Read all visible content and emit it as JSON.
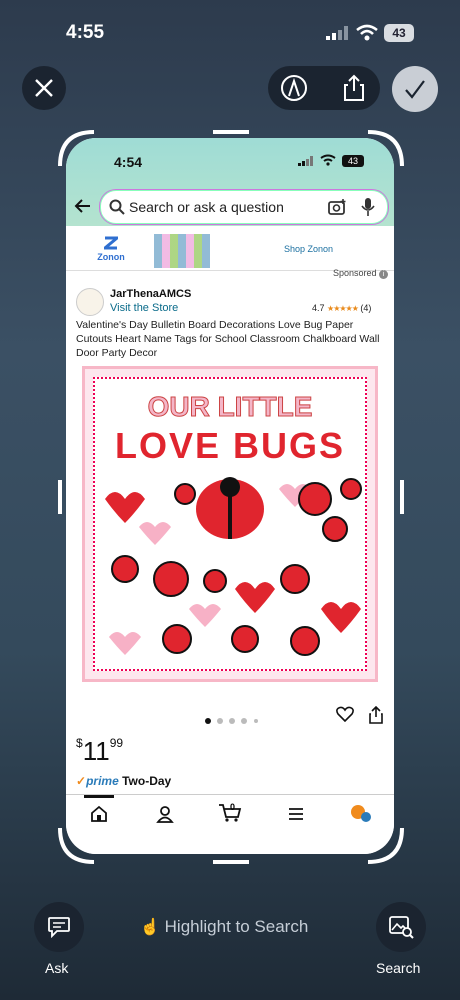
{
  "status": {
    "time": "4:55",
    "battery": "43"
  },
  "toolbar": {
    "close_icon": "close-icon",
    "markup_icon": "markup-pen-icon",
    "share_icon": "share-icon",
    "done_icon": "checkmark-icon"
  },
  "card_status": {
    "time": "4:54",
    "battery": "43"
  },
  "search": {
    "placeholder": "Search or ask a question"
  },
  "ad": {
    "brand": "Zonon",
    "cta": "Shop Zonon",
    "sponsored": "Sponsored"
  },
  "store": {
    "name": "JarThenaAMCS",
    "visit": "Visit the Store",
    "rating": "4.7",
    "rating_count": "(4)"
  },
  "product": {
    "title": "Valentine's Day Bulletin Board Decorations Love Bug Paper Cutouts Heart Name Tags for School Classroom Chalkboard Wall Door Party Decor",
    "image_line1": "OUR LITTLE",
    "image_line2": "LOVE BUGS",
    "price_dollar": "$",
    "price_whole": "11",
    "price_cents": "99",
    "prime_label": "prime",
    "shipping": "Two-Day"
  },
  "bottom": {
    "ask": "Ask",
    "highlight": "Highlight to Search",
    "search": "Search"
  }
}
